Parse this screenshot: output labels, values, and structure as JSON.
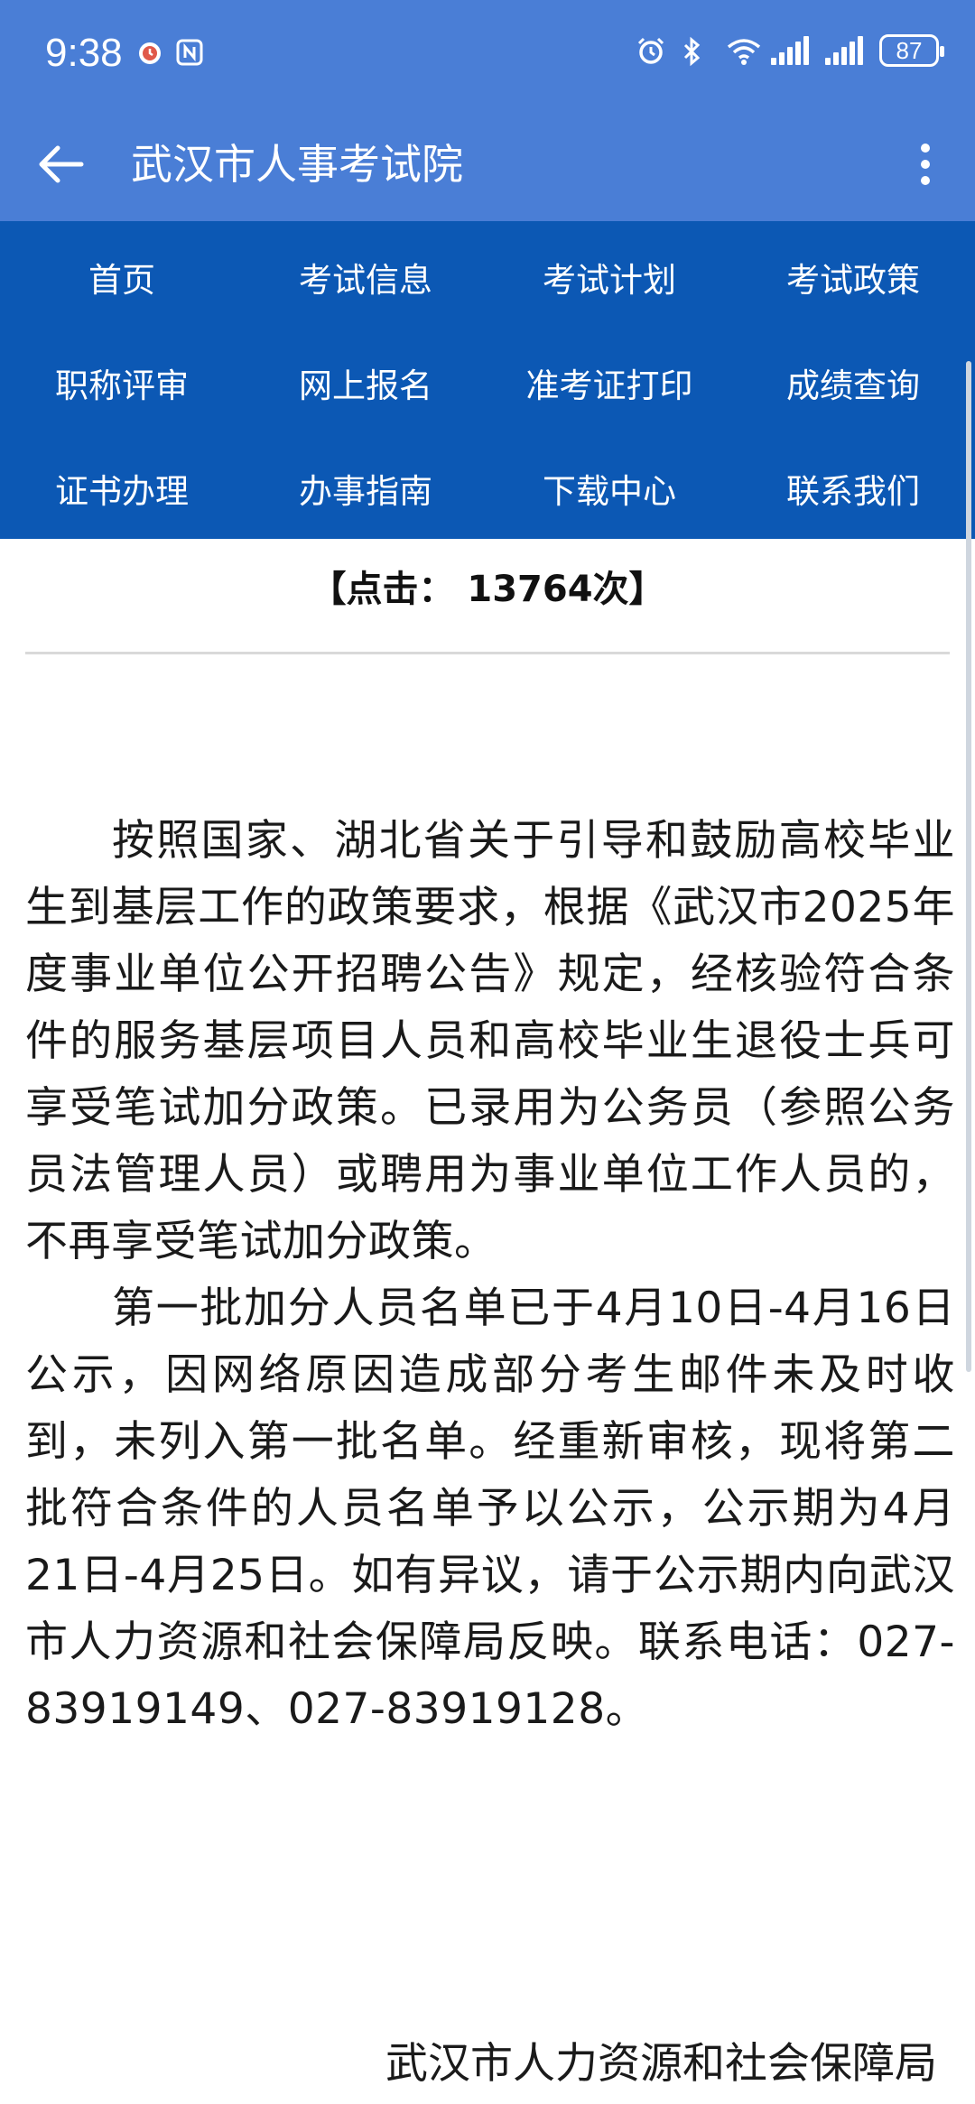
{
  "status_bar": {
    "time": "9:38",
    "battery": "87",
    "left_icons": [
      "clock-app-icon",
      "nfc-icon"
    ],
    "right_icons": [
      "alarm-icon",
      "bluetooth-icon",
      "wifi-icon",
      "signal-icon",
      "signal-icon",
      "battery-icon"
    ]
  },
  "app_bar": {
    "title": "武汉市人事考试院",
    "back_icon": "arrow-left-icon",
    "menu_icon": "more-vertical-icon"
  },
  "nav": {
    "items": [
      {
        "label": "首页"
      },
      {
        "label": "考试信息"
      },
      {
        "label": "考试计划"
      },
      {
        "label": "考试政策"
      },
      {
        "label": "职称评审"
      },
      {
        "label": "网上报名"
      },
      {
        "label": "准考证打印"
      },
      {
        "label": "成绩查询"
      },
      {
        "label": "证书办理"
      },
      {
        "label": "办事指南"
      },
      {
        "label": "下载中心"
      },
      {
        "label": "联系我们"
      }
    ]
  },
  "article": {
    "hits": "【点击： 13764次】",
    "paragraphs": [
      "按照国家、湖北省关于引导和鼓励高校毕业生到基层工作的政策要求，根据《武汉市2025年度事业单位公开招聘公告》规定，经核验符合条件的服务基层项目人员和高校毕业生退役士兵可享受笔试加分政策。已录用为公务员（参照公务员法管理人员）或聘用为事业单位工作人员的，不再享受笔试加分政策。",
      "第一批加分人员名单已于4月10日-4月16日公示，因网络原因造成部分考生邮件未及时收到，未列入第一批名单。经重新审核，现将第二批符合条件的人员名单予以公示，公示期为4月21日-4月25日。如有异议，请于公示期内向武汉市人力资源和社会保障局反映。联系电话：027-83919149、027-83919128。"
    ],
    "signature": "武汉市人力资源和社会保障局"
  },
  "colors": {
    "app_bar": "#4a7ed6",
    "nav_bg": "#0c58b4",
    "text": "#1a1a1a"
  }
}
